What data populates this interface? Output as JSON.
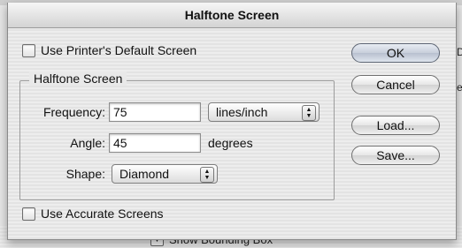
{
  "background": {
    "show_bounding_box_label": "Show Bounding Box",
    "edge_letters": [
      "D",
      "e"
    ]
  },
  "dialog": {
    "title": "Halftone Screen",
    "use_printer_default": {
      "label": "Use Printer's Default Screen",
      "checked": false
    },
    "group": {
      "legend": "Halftone Screen",
      "frequency": {
        "label": "Frequency:",
        "value": "75",
        "unit": "lines/inch"
      },
      "angle": {
        "label": "Angle:",
        "value": "45",
        "unit": "degrees"
      },
      "shape": {
        "label": "Shape:",
        "value": "Diamond"
      }
    },
    "use_accurate_screens": {
      "label": "Use Accurate Screens",
      "checked": false
    },
    "buttons": {
      "ok": "OK",
      "cancel": "Cancel",
      "load": "Load...",
      "save": "Save..."
    }
  }
}
